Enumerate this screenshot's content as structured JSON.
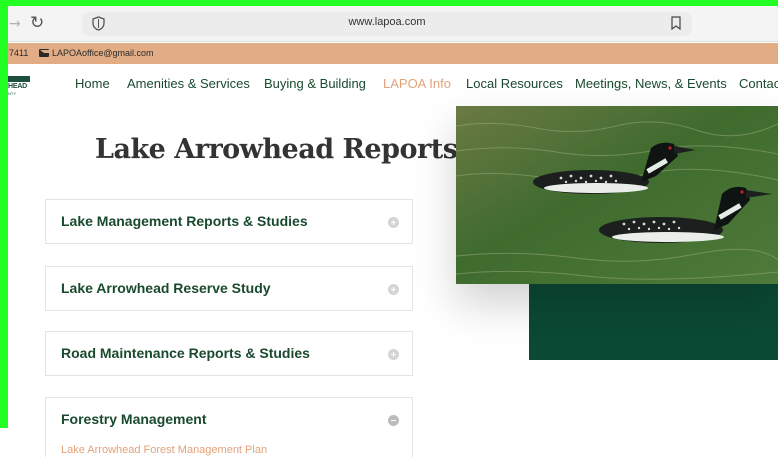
{
  "browser": {
    "url": "www.lapoa.com",
    "back_icon": "arrow-left-icon",
    "reload_icon": "reload-icon",
    "shield_icon": "shield-icon",
    "bookmark_icon": "bookmark-icon"
  },
  "contact": {
    "phone_fragment": "7411",
    "email": "LAPOAoffice@gmail.com",
    "email_icon": "mail-icon"
  },
  "logo": {
    "text": "HEAD",
    "sub": "NTY"
  },
  "nav": {
    "items": [
      {
        "label": "Home"
      },
      {
        "label": "Amenities & Services"
      },
      {
        "label": "Buying & Building"
      },
      {
        "label": "LAPOA Info"
      },
      {
        "label": "Local Resources"
      },
      {
        "label": "Meetings, News, & Events"
      },
      {
        "label": "Contac"
      }
    ],
    "active_index": 3
  },
  "page": {
    "title": "Lake Arrowhead Reports"
  },
  "accordion": [
    {
      "title": "Lake Management Reports & Studies",
      "state": "collapsed"
    },
    {
      "title": "Lake Arrowhead Reserve Study",
      "state": "collapsed"
    },
    {
      "title": "Road Maintenance Reports & Studies",
      "state": "collapsed"
    },
    {
      "title": "Forestry Management",
      "state": "expanded",
      "link": "Lake Arrowhead Forest Management Plan"
    }
  ],
  "colors": {
    "accent": "#e2a27a",
    "brand_green": "#1a4a2e",
    "panel_green": "#0b4a34",
    "strip": "#e2ac85"
  }
}
